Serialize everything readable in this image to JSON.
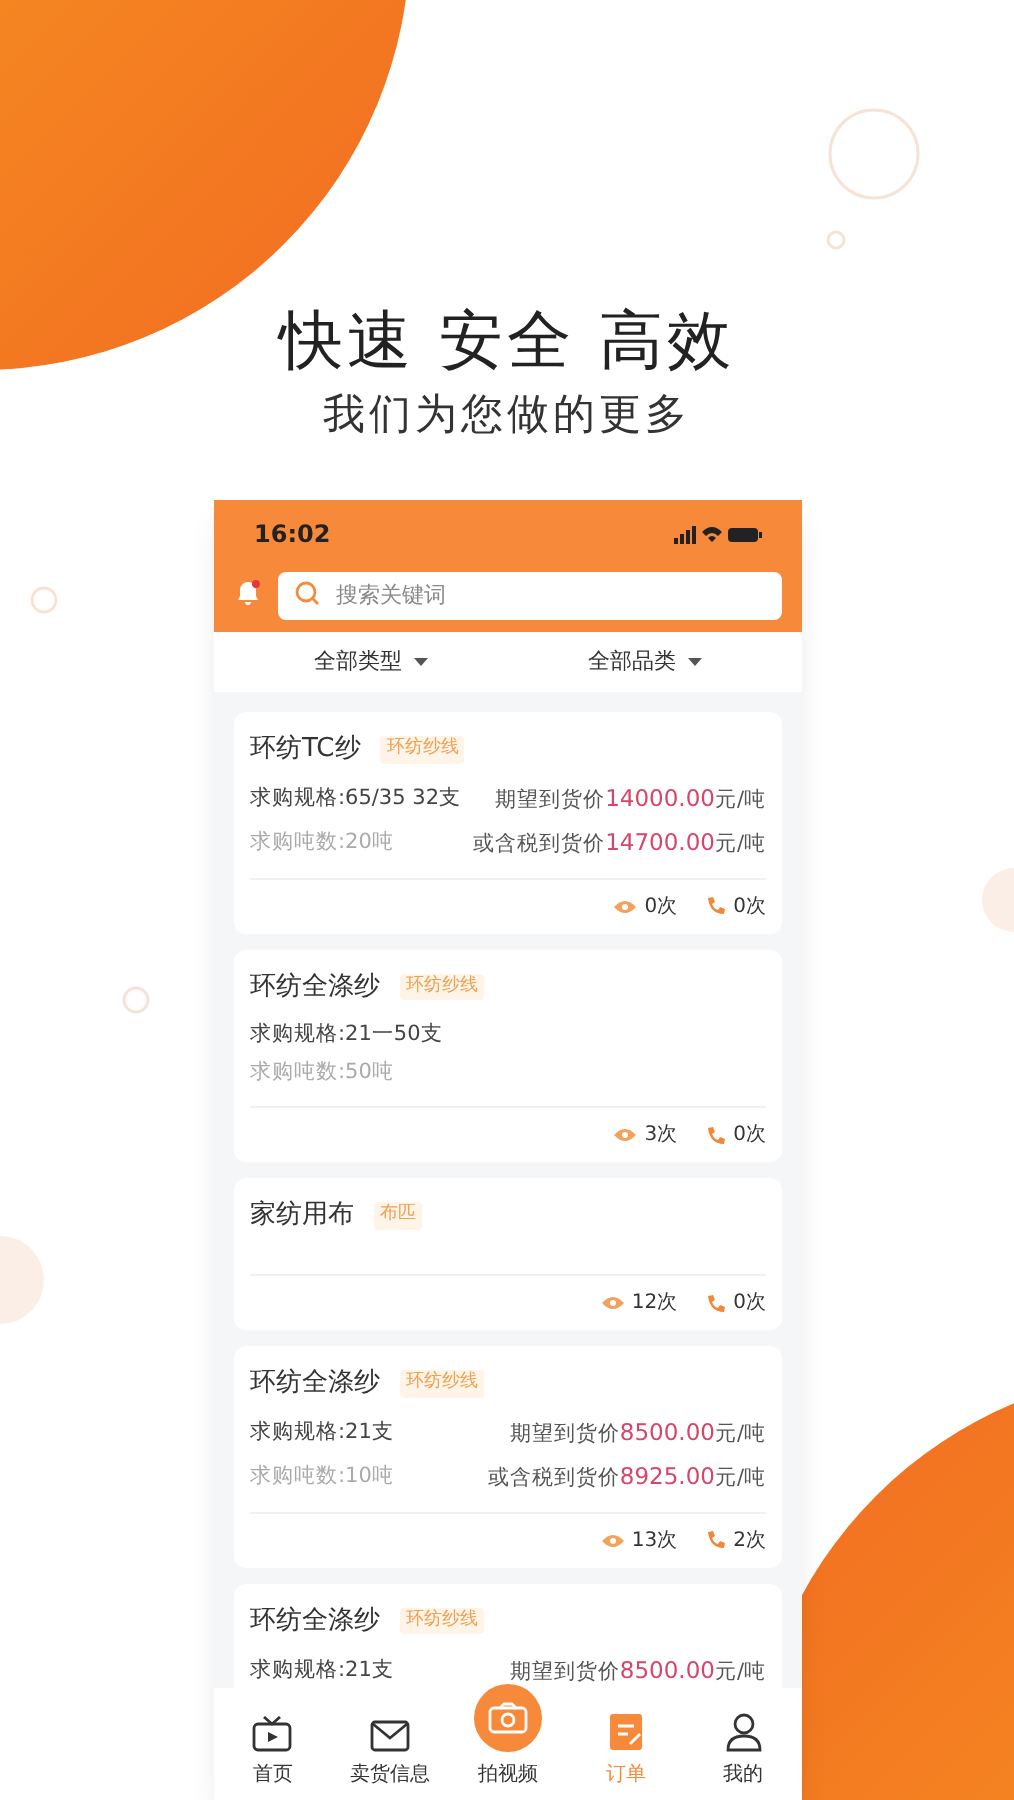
{
  "headline": "快速 安全 高效",
  "subtitle": "我们为您做的更多",
  "status_bar": {
    "time": "16:02"
  },
  "search": {
    "placeholder": "搜索关键词"
  },
  "filters": [
    {
      "label": "全部类型"
    },
    {
      "label": "全部品类"
    }
  ],
  "cards": [
    {
      "title": "环纺TC纱",
      "tag": "环纺纱线",
      "rows": [
        {
          "kind": "spec",
          "text": "求购规格:65/35 32支",
          "price_label": "期望到货价",
          "price": "14000.00",
          "unit": "元/吨"
        },
        {
          "kind": "tonnage",
          "text": "求购吨数:20吨",
          "price_label": "或含税到货价",
          "price": "14700.00",
          "unit": "元/吨"
        }
      ],
      "views": "0次",
      "calls": "0次"
    },
    {
      "title": "环纺全涤纱",
      "tag": "环纺纱线",
      "rows": [
        {
          "kind": "spec",
          "text": "求购规格:21一50支"
        },
        {
          "kind": "tonnage",
          "text": "求购吨数:50吨"
        }
      ],
      "views": "3次",
      "calls": "0次"
    },
    {
      "title": "家纺用布",
      "tag": "布匹",
      "views": "12次",
      "calls": "0次"
    },
    {
      "title": "环纺全涤纱",
      "tag": "环纺纱线",
      "rows": [
        {
          "kind": "spec",
          "text": "求购规格:21支",
          "price_label": "期望到货价",
          "price": "8500.00",
          "unit": "元/吨"
        },
        {
          "kind": "tonnage",
          "text": "求购吨数:10吨",
          "price_label": "或含税到货价",
          "price": "8925.00",
          "unit": "元/吨"
        }
      ],
      "views": "13次",
      "calls": "2次"
    },
    {
      "title": "环纺全涤纱",
      "tag": "环纺纱线",
      "rows": [
        {
          "kind": "spec",
          "text": "求购规格:21支",
          "price_label": "期望到货价",
          "price": "8500.00",
          "unit": "元/吨"
        }
      ]
    }
  ],
  "tab_bar": [
    {
      "label": "首页",
      "selected": false
    },
    {
      "label": "卖货信息",
      "selected": false
    },
    {
      "label": "拍视频",
      "selected": false
    },
    {
      "label": "订单",
      "selected": true
    },
    {
      "label": "我的",
      "selected": false
    }
  ]
}
